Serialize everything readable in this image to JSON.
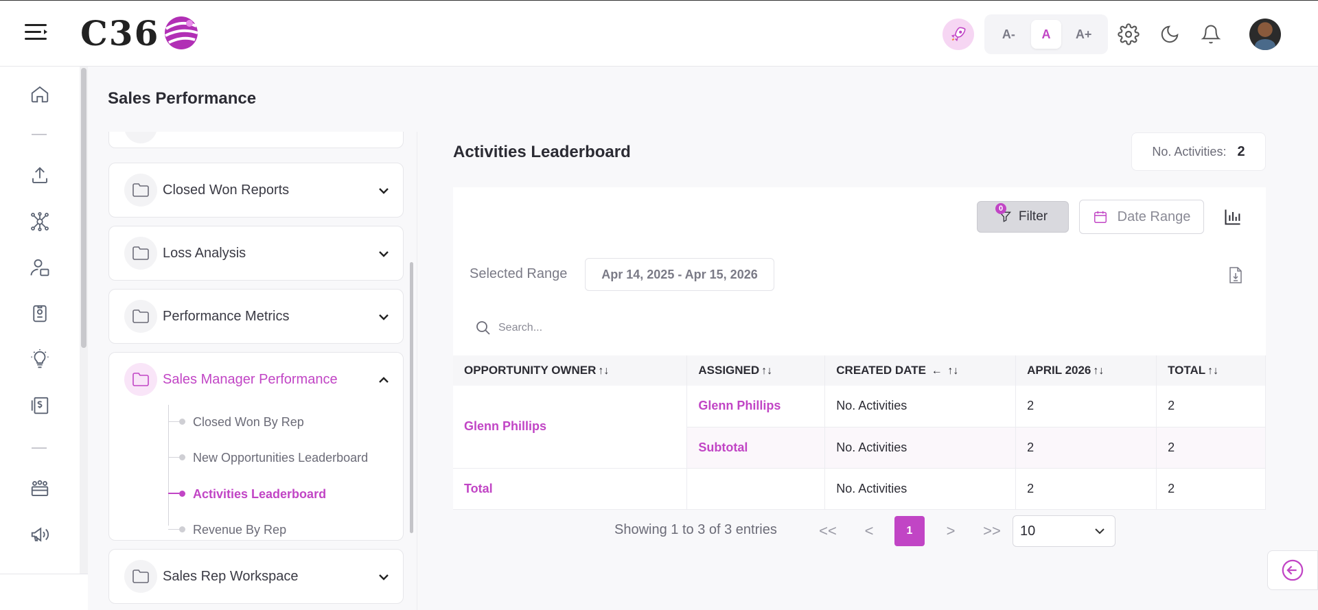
{
  "header": {
    "logo_text": "C36",
    "font_buttons": [
      "A-",
      "A",
      "A+"
    ],
    "active_font_index": 1
  },
  "page": {
    "title": "Sales Performance"
  },
  "tree": {
    "folders": [
      {
        "label": "Closed Won Reports",
        "expanded": false
      },
      {
        "label": "Loss Analysis",
        "expanded": false
      },
      {
        "label": "Performance Metrics",
        "expanded": false
      },
      {
        "label": "Sales Manager Performance",
        "expanded": true
      },
      {
        "label": "Sales Rep Workspace",
        "expanded": false
      }
    ],
    "subitems": [
      {
        "label": "Closed Won By Rep",
        "active": false
      },
      {
        "label": "New Opportunities Leaderboard",
        "active": false
      },
      {
        "label": "Activities Leaderboard",
        "active": true
      },
      {
        "label": "Revenue By Rep",
        "active": false
      }
    ]
  },
  "report": {
    "title": "Activities Leaderboard",
    "count_label": "No. Activities:",
    "count_value": "2",
    "filter_label": "Filter",
    "filter_badge": "0",
    "date_range_label": "Date Range",
    "selected_range_label": "Selected Range",
    "selected_range_value": "Apr 14, 2025 - Apr 15, 2026",
    "search_placeholder": "Search...",
    "columns": [
      "OPPORTUNITY OWNER",
      "ASSIGNED",
      "CREATED DATE",
      "APRIL 2026",
      "TOTAL"
    ],
    "sort_arrow": "↑↓",
    "created_sort_dir": "←",
    "rows": {
      "owner": "Glenn Phillips",
      "assigned": "Glenn Phillips",
      "measure": "No. Activities",
      "april": "2",
      "total": "2",
      "subtotal_label": "Subtotal",
      "subtotal_measure": "No. Activities",
      "subtotal_april": "2",
      "subtotal_total": "2",
      "total_label": "Total",
      "total_measure": "No. Activities",
      "total_april": "2",
      "total_total": "2"
    },
    "pagination": {
      "info": "Showing 1 to 3 of 3 entries",
      "first": "<<",
      "prev": "<",
      "current": "1",
      "next": ">",
      "last": ">>",
      "page_size": "10"
    }
  },
  "colors": {
    "accent": "#c145c5",
    "accent_light": "#f9e5f8"
  }
}
